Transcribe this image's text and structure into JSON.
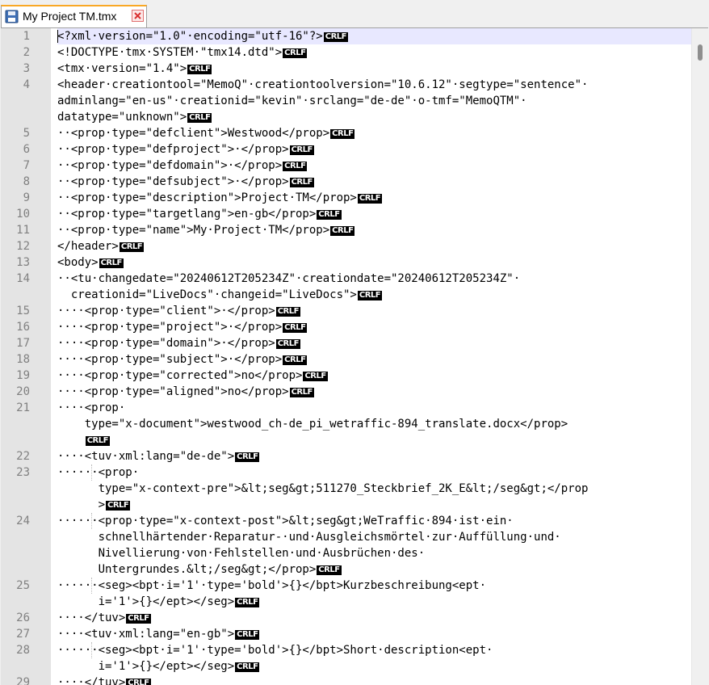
{
  "tab": {
    "title": "My Project TM.tmx"
  },
  "icons": {
    "save": "floppy-disk-icon",
    "close": "close-tab-icon"
  },
  "eol_marker": "CRLF",
  "lines": [
    {
      "n": "1",
      "segments": [
        {
          "text": "<?xml·version=\"1.0\"·encoding=\"utf-16\"?>",
          "eol": true
        }
      ]
    },
    {
      "n": "2",
      "segments": [
        {
          "text": "<!DOCTYPE·tmx·SYSTEM·\"tmx14.dtd\">",
          "eol": true
        }
      ]
    },
    {
      "n": "3",
      "segments": [
        {
          "text": "<tmx·version=\"1.4\">",
          "eol": true
        }
      ]
    },
    {
      "n": "4",
      "segments": [
        {
          "text": "<header·creationtool=\"MemoQ\"·creationtoolversion=\"10.6.12\"·segtype=\"sentence\"·",
          "eol": false
        },
        {
          "text": "adminlang=\"en-us\"·creationid=\"kevin\"·srclang=\"de-de\"·o-tmf=\"MemoQTM\"·",
          "eol": false
        },
        {
          "text": "datatype=\"unknown\">",
          "eol": true
        }
      ]
    },
    {
      "n": "5",
      "segments": [
        {
          "text": "··<prop·type=\"defclient\">Westwood</prop>",
          "eol": true
        }
      ]
    },
    {
      "n": "6",
      "segments": [
        {
          "text": "··<prop·type=\"defproject\">·</prop>",
          "eol": true
        }
      ]
    },
    {
      "n": "7",
      "segments": [
        {
          "text": "··<prop·type=\"defdomain\">·</prop>",
          "eol": true
        }
      ]
    },
    {
      "n": "8",
      "segments": [
        {
          "text": "··<prop·type=\"defsubject\">·</prop>",
          "eol": true
        }
      ]
    },
    {
      "n": "9",
      "segments": [
        {
          "text": "··<prop·type=\"description\">Project·TM</prop>",
          "eol": true
        }
      ]
    },
    {
      "n": "10",
      "segments": [
        {
          "text": "··<prop·type=\"targetlang\">en-gb</prop>",
          "eol": true
        }
      ]
    },
    {
      "n": "11",
      "segments": [
        {
          "text": "··<prop·type=\"name\">My·Project·TM</prop>",
          "eol": true
        }
      ]
    },
    {
      "n": "12",
      "segments": [
        {
          "text": "</header>",
          "eol": true
        }
      ]
    },
    {
      "n": "13",
      "segments": [
        {
          "text": "<body>",
          "eol": true
        }
      ]
    },
    {
      "n": "14",
      "segments": [
        {
          "text": "··<tu·changedate=\"20240612T205234Z\"·creationdate=\"20240612T205234Z\"·",
          "eol": false
        },
        {
          "text": "  creationid=\"LiveDocs\"·changeid=\"LiveDocs\">",
          "eol": true
        }
      ]
    },
    {
      "n": "15",
      "segments": [
        {
          "text": "····<prop·type=\"client\">·</prop>",
          "eol": true
        }
      ]
    },
    {
      "n": "16",
      "segments": [
        {
          "text": "····<prop·type=\"project\">·</prop>",
          "eol": true
        }
      ]
    },
    {
      "n": "17",
      "segments": [
        {
          "text": "····<prop·type=\"domain\">·</prop>",
          "eol": true
        }
      ]
    },
    {
      "n": "18",
      "segments": [
        {
          "text": "····<prop·type=\"subject\">·</prop>",
          "eol": true
        }
      ]
    },
    {
      "n": "19",
      "segments": [
        {
          "text": "····<prop·type=\"corrected\">no</prop>",
          "eol": true
        }
      ]
    },
    {
      "n": "20",
      "segments": [
        {
          "text": "····<prop·type=\"aligned\">no</prop>",
          "eol": true
        }
      ]
    },
    {
      "n": "21",
      "segments": [
        {
          "text": "····<prop·",
          "eol": false
        },
        {
          "text": "    type=\"x-document\">westwood_ch-de_pi_wetraffic-894_translate.docx</prop>",
          "eol": false
        },
        {
          "text": "    ",
          "eol": true
        }
      ]
    },
    {
      "n": "22",
      "segments": [
        {
          "text": "····<tuv·xml:lang=\"de-de\">",
          "eol": true
        }
      ]
    },
    {
      "n": "23",
      "segments": [
        {
          "text": "······<prop·",
          "eol": false
        },
        {
          "text": "      type=\"x-context-pre\">&lt;seg&gt;511270_Steckbrief_2K_E&lt;/seg&gt;</prop",
          "eol": false
        },
        {
          "text": "      >",
          "eol": true
        }
      ]
    },
    {
      "n": "24",
      "segments": [
        {
          "text": "······<prop·type=\"x-context-post\">&lt;seg&gt;WeTraffic·894·ist·ein·",
          "eol": false
        },
        {
          "text": "      schnellhärtender·Reparatur-·und·Ausgleichsmörtel·zur·Auffüllung·und·",
          "eol": false
        },
        {
          "text": "      Nivellierung·von·Fehlstellen·und·Ausbrüchen·des·",
          "eol": false
        },
        {
          "text": "      Untergrundes.&lt;/seg&gt;</prop>",
          "eol": true
        }
      ]
    },
    {
      "n": "25",
      "segments": [
        {
          "text": "······<seg><bpt·i='1'·type='bold'>{}</bpt>Kurzbeschreibung<ept·",
          "eol": false
        },
        {
          "text": "      i='1'>{}</ept></seg>",
          "eol": true
        }
      ]
    },
    {
      "n": "26",
      "segments": [
        {
          "text": "····</tuv>",
          "eol": true
        }
      ]
    },
    {
      "n": "27",
      "segments": [
        {
          "text": "····<tuv·xml:lang=\"en-gb\">",
          "eol": true
        }
      ]
    },
    {
      "n": "28",
      "segments": [
        {
          "text": "······<seg><bpt·i='1'·type='bold'>{}</bpt>Short·description<ept·",
          "eol": false
        },
        {
          "text": "      i='1'>{}</ept></seg>",
          "eol": true
        }
      ]
    },
    {
      "n": "29",
      "segments": [
        {
          "text": "····</tuv>",
          "eol": true
        }
      ]
    }
  ]
}
